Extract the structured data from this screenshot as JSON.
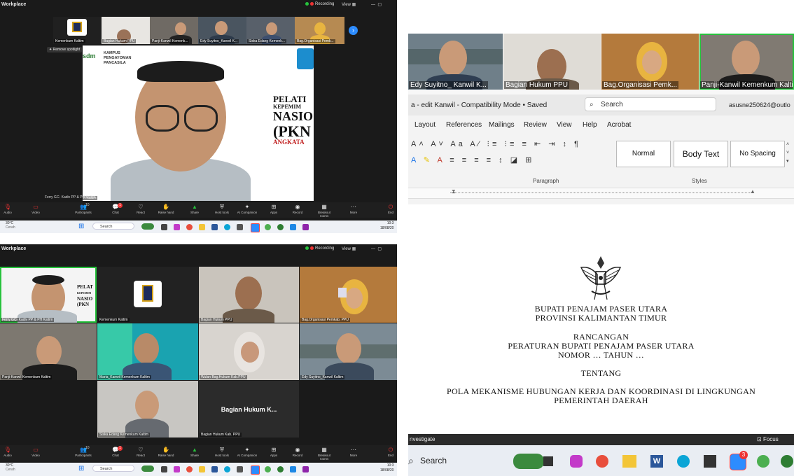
{
  "zoom_top": {
    "app_title": "Workplace",
    "recording": "Recording",
    "view": "View",
    "remove_spotlight": "Remove spotlight",
    "strip": [
      {
        "name": "Kemenkum Kaltim"
      },
      {
        "name": "Bagian Hukum PPU"
      },
      {
        "name": "Panji-Kanwil Kemenk..."
      },
      {
        "name": "Edy Suyitno_Kanwil K..."
      },
      {
        "name": "Siska Edang Kemenk..."
      },
      {
        "name": "Bag.Organisasi Pemk..."
      }
    ],
    "speaker_name": "Ferry GC- Kadiv PP & PH Kaltim",
    "slide": {
      "logo_line1": "sdm",
      "logo_line2": "KAMPUS",
      "logo_line3": "PENGAYOMAN",
      "logo_line4": "PANCASILA",
      "text1": "PELATI",
      "text2": "KEPEMIM",
      "text3": "NASIO",
      "text4": "(PKN",
      "text5": "ANGKATA"
    }
  },
  "zoom_bottom": {
    "app_title": "Workplace",
    "recording": "Recording",
    "view": "View",
    "tiles": [
      {
        "name": "Ferry GC- Kadiv PP & PH Kaltim"
      },
      {
        "name": "Kemenkum Kaltim"
      },
      {
        "name": "Bagian Hukum PPU"
      },
      {
        "name": "Bag.Organisasi Pemkab. PPU"
      },
      {
        "name": "Panji-Kanwil Kemenkum Kaltim"
      },
      {
        "name": "Maria_Kanwil Kemenkum Kaltim"
      },
      {
        "name": "Wulan Bag.Hukum Kab.PPU"
      },
      {
        "name": "Edy Suyitno_Kanwil Kaltim"
      },
      {
        "name": "Siska Edang Kemenkum Kaltim"
      },
      {
        "name": "Bagian Hukum Kab. PPU"
      }
    ],
    "big_label": "Bagian Hukum K..."
  },
  "toolbar": {
    "items": [
      {
        "label": "Audio",
        "icon": "microphone-icon"
      },
      {
        "label": "Video",
        "icon": "video-icon"
      },
      {
        "label": "Participants",
        "icon": "participants-icon"
      },
      {
        "label": "Chat",
        "icon": "chat-icon"
      },
      {
        "label": "React",
        "icon": "react-icon"
      },
      {
        "label": "Raise hand",
        "icon": "hand-icon"
      },
      {
        "label": "Share",
        "icon": "share-icon"
      },
      {
        "label": "Host tools",
        "icon": "shield-icon"
      },
      {
        "label": "AI Companion",
        "icon": "sparkle-icon"
      },
      {
        "label": "Apps",
        "icon": "apps-icon"
      },
      {
        "label": "Record",
        "icon": "record-icon"
      },
      {
        "label": "Breakout rooms",
        "icon": "grid-icon"
      },
      {
        "label": "More",
        "icon": "more-icon"
      },
      {
        "label": "End",
        "icon": "end-icon"
      }
    ],
    "participants_count": "10",
    "chat_badge": "1"
  },
  "taskbar": {
    "temp": "30°C",
    "weather": "Cerah",
    "search": "Search",
    "time_top": "10:3",
    "date_top": "18/08/20",
    "time_bottom": "10:3",
    "date_bottom": "18/08/20"
  },
  "right_zoom": {
    "tiles": [
      {
        "name": "Edy Suyitno_ Kanwil K..."
      },
      {
        "name": "Bagian Hukum PPU"
      },
      {
        "name": "Bag.Organisasi Pemk..."
      },
      {
        "name": "Panji-Kanwil Kemenkum Kalti"
      }
    ]
  },
  "word": {
    "title": "a - edit Kanwil  -  Compatibility Mode  •  Saved",
    "search": "Search",
    "account": "asusne250624@outlo",
    "tabs": [
      "Layout",
      "References",
      "Mailings",
      "Review",
      "View",
      "Help",
      "Acrobat"
    ],
    "styles": [
      "Normal",
      "Body Text",
      "No Spacing"
    ],
    "group_paragraph": "Paragraph",
    "group_styles": "Styles",
    "doc": {
      "line1": "BUPATI PENAJAM PASER UTARA",
      "line2": "PROVINSI KALIMANTAN TIMUR",
      "line3": "RANCANGAN",
      "line4": "PERATURAN BUPATI PENAJAM PASER UTARA",
      "line5": "NOMOR … TAHUN …",
      "line6": "TENTANG",
      "line7": "POLA MEKANISME HUBUNGAN KERJA DAN KOORDINASI DI LINGKUNGAN",
      "line8": "PEMERINTAH DAERAH"
    },
    "status_left": "nvestigate",
    "focus": "Focus",
    "taskbar_search": "Search",
    "badge": "3"
  }
}
